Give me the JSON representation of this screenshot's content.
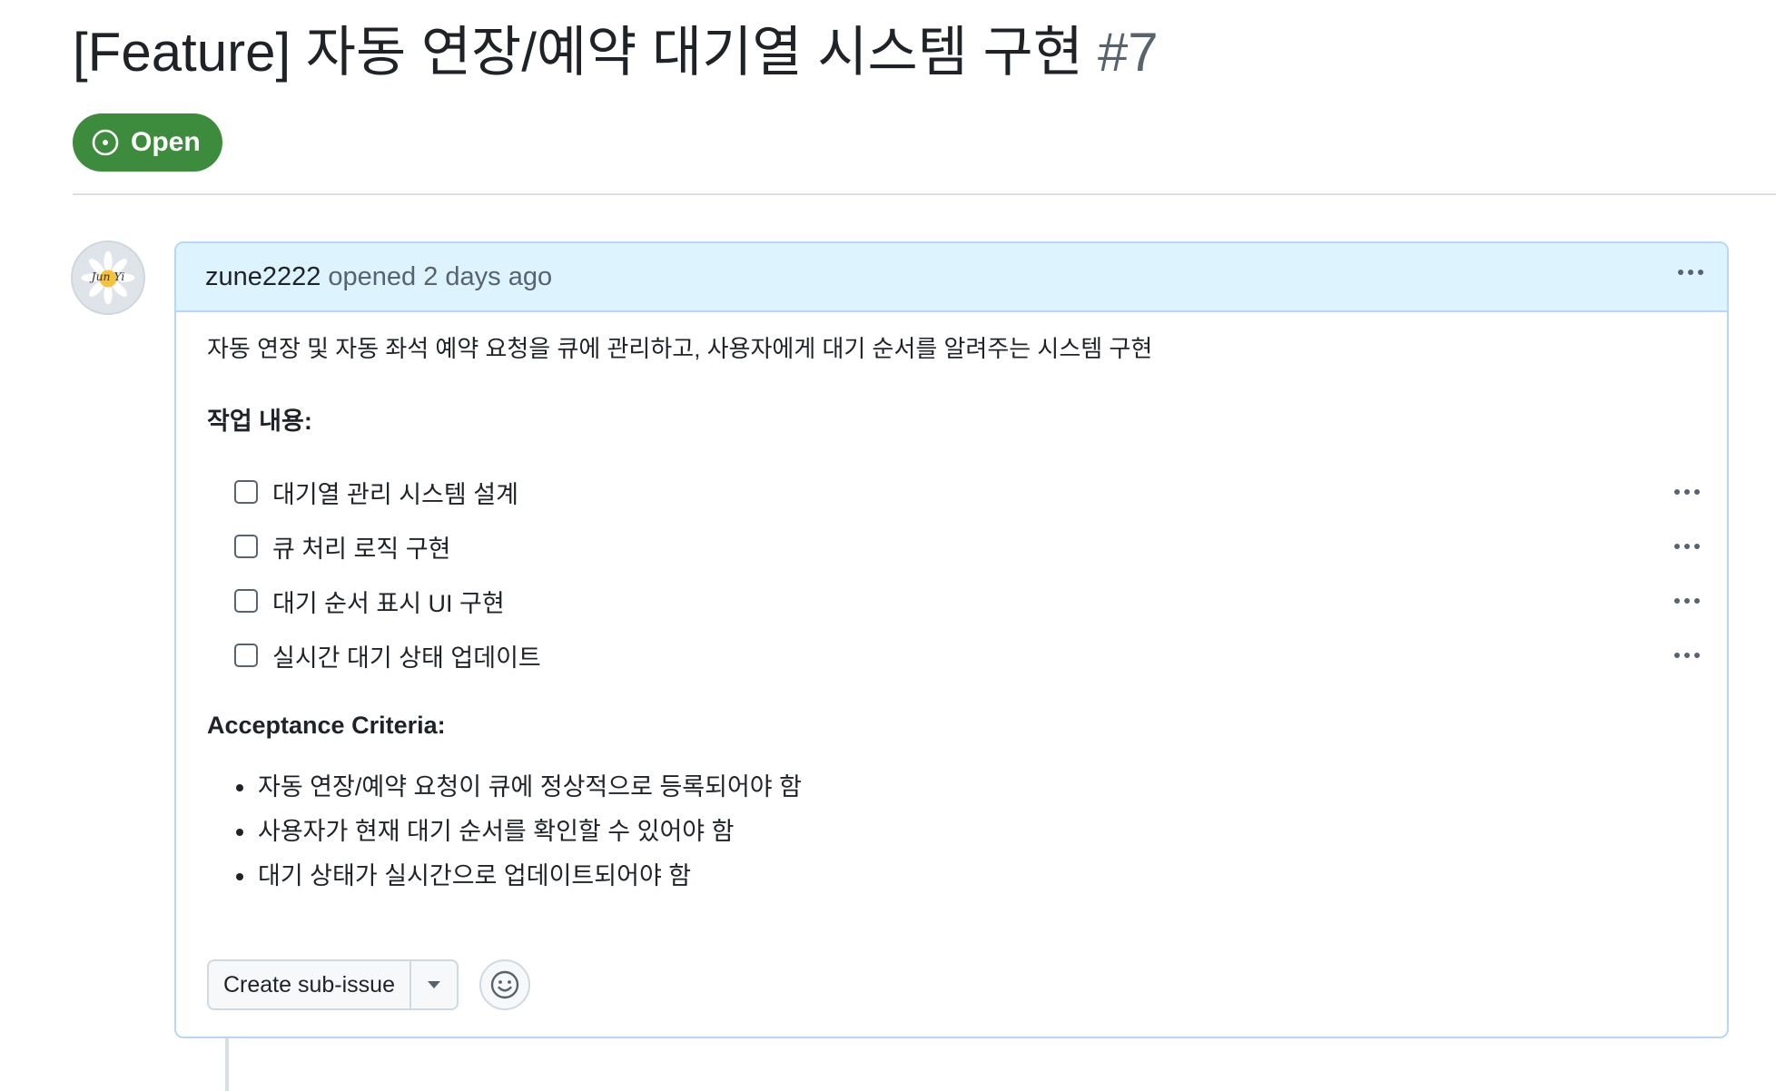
{
  "issue": {
    "title": "[Feature] 자동 연장/예약 대기열 시스템 구현",
    "number": "#7",
    "state": "Open",
    "state_color": "#3d8b3d"
  },
  "comment": {
    "author": "zune2222",
    "opened_text": "opened 2 days ago",
    "avatar_text": "Jun Yi",
    "description": "자동 연장 및 자동 좌석 예약 요청을 큐에 관리하고, 사용자에게 대기 순서를 알려주는 시스템 구현",
    "tasks_heading": "작업 내용:",
    "tasks": [
      {
        "label": "대기열 관리 시스템 설계",
        "checked": false
      },
      {
        "label": "큐 처리 로직 구현",
        "checked": false
      },
      {
        "label": "대기 순서 표시 UI 구현",
        "checked": false
      },
      {
        "label": "실시간 대기 상태 업데이트",
        "checked": false
      }
    ],
    "criteria_heading": "Acceptance Criteria:",
    "criteria": [
      "자동 연장/예약 요청이 큐에 정상적으로 등록되어야 함",
      "사용자가 현재 대기 순서를 확인할 수 있어야 함",
      "대기 상태가 실시간으로 업데이트되어야 함"
    ],
    "sub_issue_button": "Create sub-issue"
  },
  "icons": {
    "state": "issue-opened-icon",
    "menu": "kebab-horizontal-icon",
    "dropdown": "triangle-down-icon",
    "reaction": "smiley-icon"
  },
  "colors": {
    "header_bg": "#ddf4ff",
    "border": "#b6d7f7"
  }
}
